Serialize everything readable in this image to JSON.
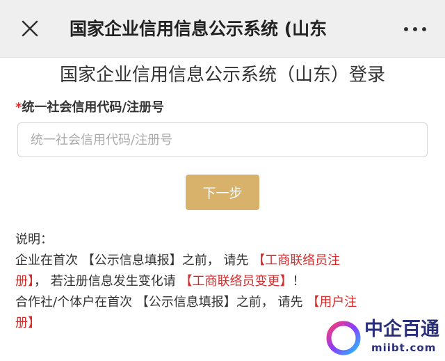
{
  "header": {
    "title": "国家企业信用信息公示系统 (山东",
    "close_icon": "close-icon",
    "more_icon": "more-dots-icon"
  },
  "login": {
    "title": "国家企业信用信息公示系统（山东）登录",
    "field_required_mark": "*",
    "field_label": "统一社会信用代码/注册号",
    "field_placeholder": "统一社会信用代码/注册号",
    "field_value": "",
    "next_button": "下一步"
  },
  "notes": {
    "heading": "说明：",
    "line2_text": "企业在首次 【公示信息填报】之前， 请先 ",
    "line2_link": "【工商联络员注",
    "line3_link": "册】",
    "line3_text": "， 若注册信息发生变化请 ",
    "line3_link2": "【工商联络员变更】",
    "line3_tail": "！",
    "line4_text": "合作社/个体户在首次 【公示信息填报】之前， 请先 ",
    "line4_link": "【用户注",
    "line5_link": "册】"
  },
  "watermark": {
    "name": "中企百通",
    "domain": "miibt.com"
  },
  "colors": {
    "accent_button": "#d8b26a",
    "link_red": "#d62b2b",
    "topbar_bg": "#efefef",
    "watermark_blue": "#2a2f7a"
  }
}
